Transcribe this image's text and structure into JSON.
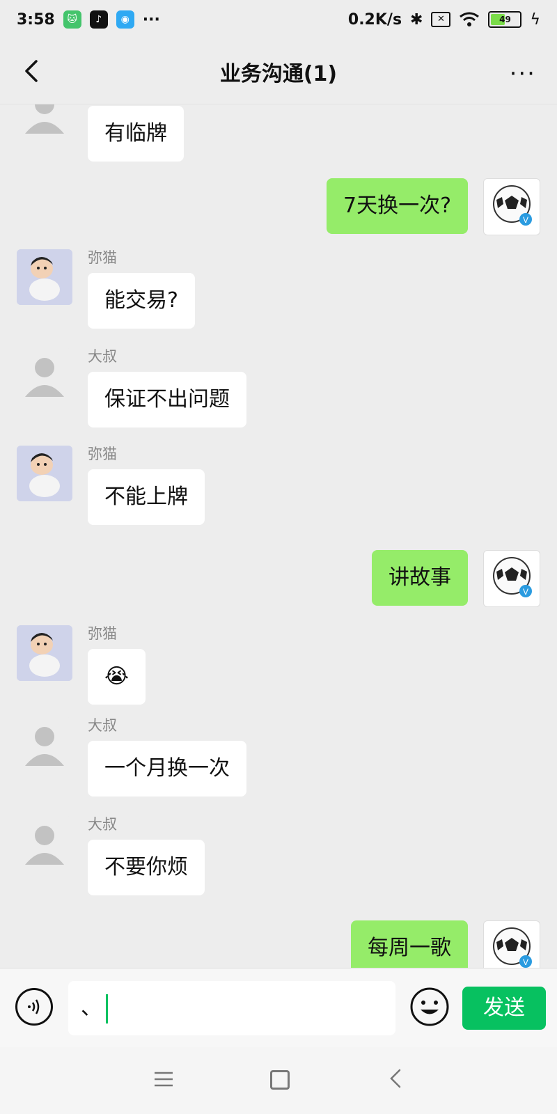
{
  "status_bar": {
    "time": "3:58",
    "more_dots": "···",
    "network_speed": "0.2K/s",
    "battery_level": "49"
  },
  "header": {
    "title": "业务沟通(1)",
    "more": "···"
  },
  "messages": [
    {
      "side": "left",
      "sender": "",
      "avatar": "default-avatar-icon",
      "text": "有临牌"
    },
    {
      "side": "right",
      "text": "7天换一次?"
    },
    {
      "side": "left",
      "sender": "弥猫",
      "avatar": "cartoon-avatar",
      "text": "能交易?"
    },
    {
      "side": "left",
      "sender": "大叔",
      "avatar": "default-avatar-icon",
      "text": "保证不出问题"
    },
    {
      "side": "left",
      "sender": "弥猫",
      "avatar": "cartoon-avatar",
      "text": "不能上牌"
    },
    {
      "side": "right",
      "text": "讲故事"
    },
    {
      "side": "left",
      "sender": "弥猫",
      "avatar": "cartoon-avatar",
      "text": "😭"
    },
    {
      "side": "left",
      "sender": "大叔",
      "avatar": "default-avatar-icon",
      "text": "一个月换一次"
    },
    {
      "side": "left",
      "sender": "大叔",
      "avatar": "default-avatar-icon",
      "text": "不要你烦"
    },
    {
      "side": "right",
      "text": "每周一歌"
    }
  ],
  "input": {
    "value": "、",
    "send_label": "发送"
  },
  "colors": {
    "background": "#ededed",
    "sent_bubble": "#95ec69",
    "received_bubble": "#ffffff",
    "send_button": "#07c160"
  }
}
